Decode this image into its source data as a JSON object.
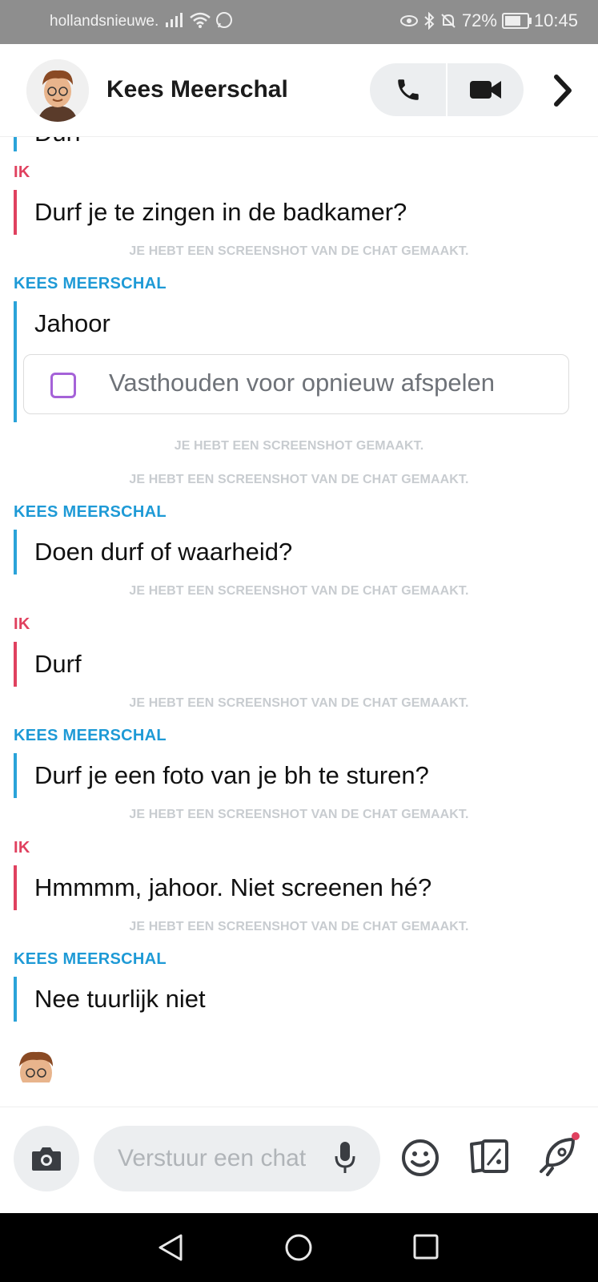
{
  "status_bar": {
    "carrier": "hollandsnieuwe.",
    "battery": "72%",
    "battery_level": 0.72,
    "time": "10:45"
  },
  "header": {
    "contact_name": "Kees Meerschal"
  },
  "chat": {
    "cutoff_text": "Durf",
    "messages": [
      {
        "sender": "IK",
        "text": "Durf je te zingen in de badkamer?"
      },
      {
        "notice": "JE HEBT EEN SCREENSHOT VAN DE CHAT GEMAAKT."
      },
      {
        "sender": "KEES MEERSCHAL",
        "text": "Jahoor",
        "replay_label": "Vasthouden voor opnieuw afspelen"
      },
      {
        "notice": "JE HEBT EEN SCREENSHOT GEMAAKT."
      },
      {
        "notice": "JE HEBT EEN SCREENSHOT VAN DE CHAT GEMAAKT."
      },
      {
        "sender": "KEES MEERSCHAL",
        "text": "Doen durf of waarheid?"
      },
      {
        "notice": "JE HEBT EEN SCREENSHOT VAN DE CHAT GEMAAKT."
      },
      {
        "sender": "IK",
        "text": "Durf"
      },
      {
        "notice": "JE HEBT EEN SCREENSHOT VAN DE CHAT GEMAAKT."
      },
      {
        "sender": "KEES MEERSCHAL",
        "text": "Durf je een foto van je bh te sturen?"
      },
      {
        "notice": "JE HEBT EEN SCREENSHOT VAN DE CHAT GEMAAKT."
      },
      {
        "sender": "IK",
        "text": "Hmmmm, jahoor. Niet screenen hé?"
      },
      {
        "notice": "JE HEBT EEN SCREENSHOT VAN DE CHAT GEMAAKT."
      },
      {
        "sender": "KEES MEERSCHAL",
        "text": "Nee tuurlijk niet"
      }
    ]
  },
  "composer": {
    "placeholder": "Verstuur een chat"
  },
  "colors": {
    "me": "#e0415f",
    "friend": "#1e9ad6",
    "notice": "#c8ccd0",
    "replay_checkbox": "#a562d8"
  },
  "icons": [
    "phone-icon",
    "video-icon",
    "chevron-right-icon",
    "camera-icon",
    "mic-icon",
    "emoji-icon",
    "cards-icon",
    "rocket-icon",
    "back-icon",
    "home-icon",
    "recents-icon"
  ]
}
